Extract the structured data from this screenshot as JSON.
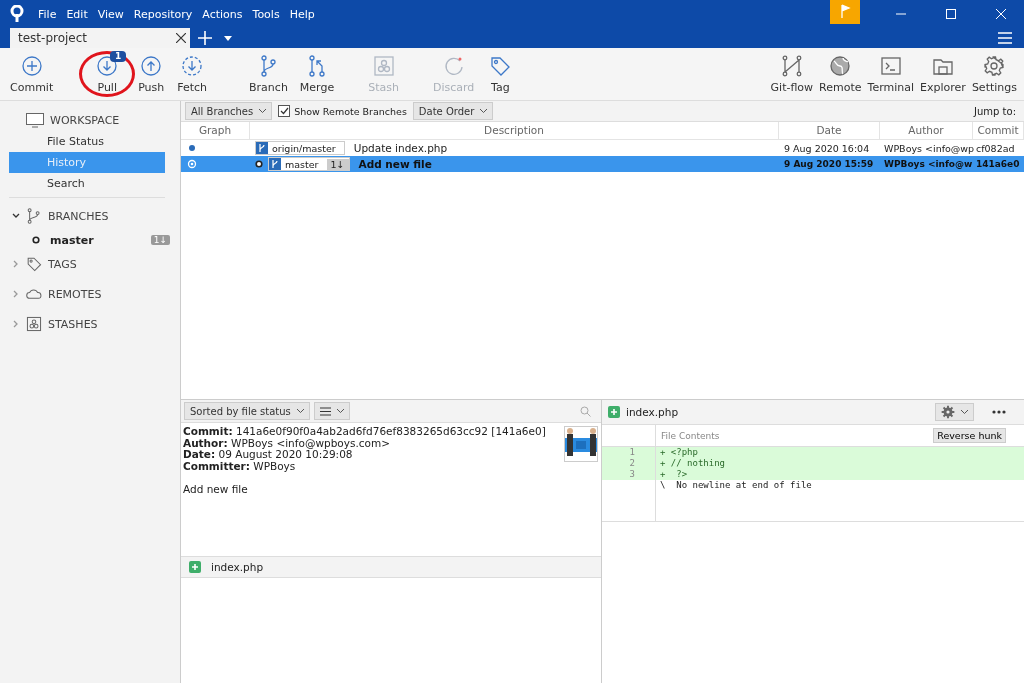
{
  "menu": [
    "File",
    "Edit",
    "View",
    "Repository",
    "Actions",
    "Tools",
    "Help"
  ],
  "tab": {
    "title": "test-project"
  },
  "toolbar_left": [
    {
      "label": "Commit",
      "disabled": false
    },
    {
      "label": "Pull",
      "disabled": false,
      "badge": "1",
      "highlighted": true
    },
    {
      "label": "Push",
      "disabled": false
    },
    {
      "label": "Fetch",
      "disabled": false
    },
    {
      "label": "Branch",
      "disabled": false
    },
    {
      "label": "Merge",
      "disabled": false
    },
    {
      "label": "Stash",
      "disabled": true
    },
    {
      "label": "Discard",
      "disabled": true
    },
    {
      "label": "Tag",
      "disabled": false
    }
  ],
  "toolbar_right": [
    {
      "label": "Git-flow"
    },
    {
      "label": "Remote"
    },
    {
      "label": "Terminal"
    },
    {
      "label": "Explorer"
    },
    {
      "label": "Settings"
    }
  ],
  "sidebar": {
    "workspace": {
      "title": "WORKSPACE",
      "items": [
        {
          "label": "File Status",
          "selected": false
        },
        {
          "label": "History",
          "selected": true
        },
        {
          "label": "Search",
          "selected": false
        }
      ]
    },
    "sections": [
      {
        "title": "BRANCHES",
        "expanded": true,
        "children": [
          {
            "label": "master",
            "count": "1↓"
          }
        ]
      },
      {
        "title": "TAGS",
        "expanded": false
      },
      {
        "title": "REMOTES",
        "expanded": false
      },
      {
        "title": "STASHES",
        "expanded": false
      }
    ]
  },
  "filters": {
    "branches": "All Branches",
    "show_remote": {
      "label": "Show Remote Branches",
      "checked": true
    },
    "order": "Date Order",
    "jump": "Jump to:"
  },
  "table": {
    "columns": [
      "Graph",
      "Description",
      "Date",
      "Author",
      "Commit"
    ],
    "rows": [
      {
        "selected": false,
        "current": false,
        "refs": [
          {
            "name": "origin/master"
          }
        ],
        "description": "Update index.php",
        "date": "9 Aug 2020 16:04",
        "author": "WPBoys <info@wp",
        "commit": "cf082ad"
      },
      {
        "selected": true,
        "current": true,
        "refs": [
          {
            "name": "master",
            "behind": "1↓"
          }
        ],
        "description": "Add new file",
        "date": "9 Aug 2020 15:59",
        "author": "WPBoys <info@w",
        "commit": "141a6e0"
      }
    ]
  },
  "files_panel": {
    "sort": "Sorted by file status",
    "details": [
      "**Commit:** 141a6e0f90f0a4ab2ad6fd76ef8383265d63cc92 [141a6e0]",
      "**Author:** WPBoys <info@wpboys.com>",
      "**Date:** 09 August 2020 10:29:08",
      "**Committer:** WPBoys"
    ],
    "message": "Add new file",
    "avatar": {
      "kind": "picture"
    },
    "files": [
      {
        "name": "index.php"
      }
    ]
  },
  "diff": {
    "file": "index.php",
    "header": "File Contents",
    "reverse": "Reverse hunk",
    "lines": [
      {
        "kind": "added",
        "num": "1",
        "text": "+ <?php"
      },
      {
        "kind": "added",
        "num": "2",
        "text": "+ // nothing"
      },
      {
        "kind": "added",
        "num": "3",
        "text": "+  ?>"
      },
      {
        "kind": "context",
        "text": "\\  No newline at end of file"
      }
    ]
  }
}
